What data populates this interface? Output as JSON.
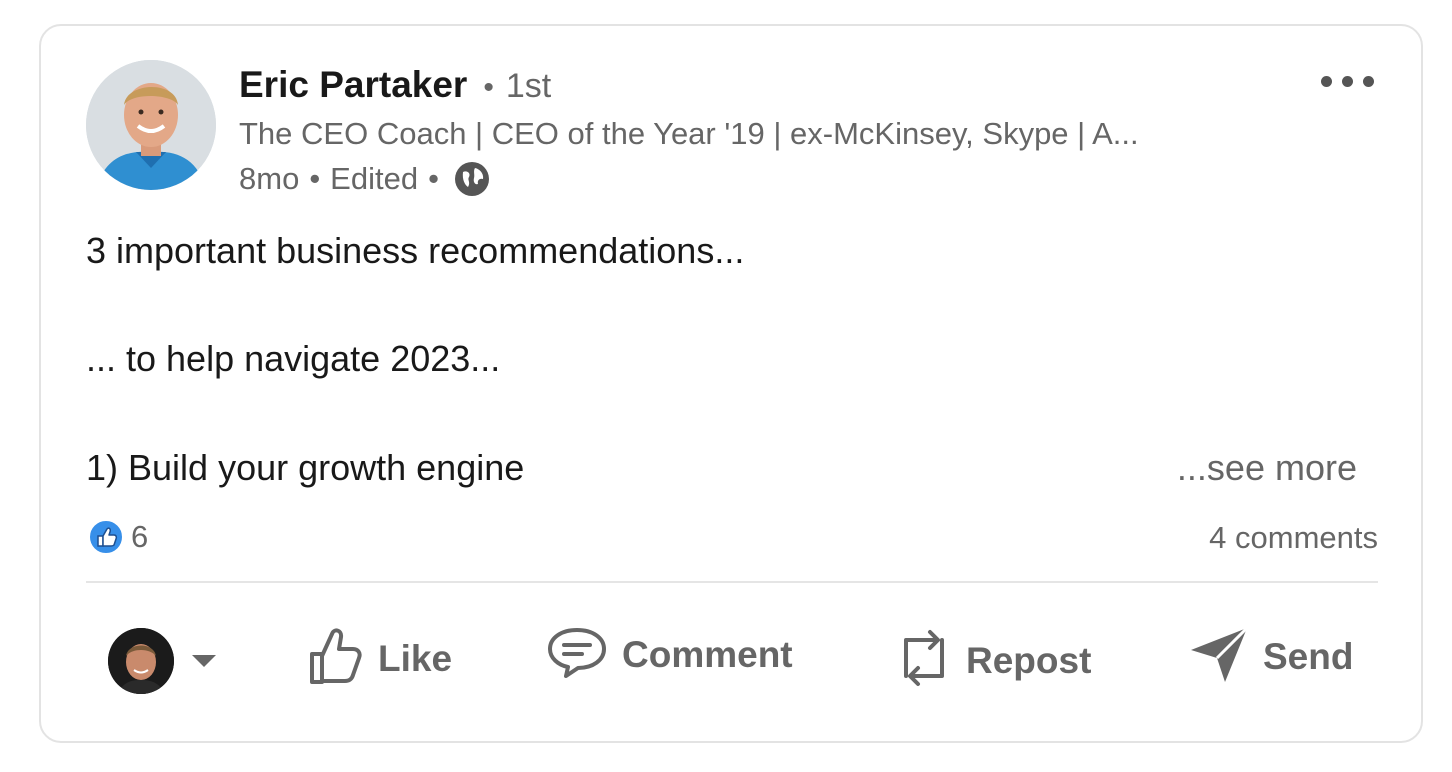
{
  "post": {
    "author": {
      "name": "Eric Partaker",
      "degree": "1st",
      "headline": "The CEO Coach | CEO of the Year '19 | ex-McKinsey, Skype | A...",
      "avatar_icon": "author-avatar-photo"
    },
    "meta": {
      "age": "8mo",
      "edited": "Edited",
      "visibility_icon": "globe-icon"
    },
    "more_icon": "more-options-icon",
    "text": {
      "line1": "3 important business recommendations...",
      "line2": "... to help navigate 2023...",
      "line3": "1) Build your growth engine",
      "see_more": "...see more"
    },
    "social": {
      "reaction_icon": "like-reaction-icon",
      "reaction_count": "6",
      "comments": "4 comments"
    },
    "actions": {
      "actor_icon": "current-user-avatar",
      "like": "Like",
      "comment": "Comment",
      "repost": "Repost",
      "send": "Send"
    }
  },
  "colors": {
    "muted_text": "#666666",
    "primary_text": "#191919",
    "like_blue": "#378fe9",
    "border": "#e3e3e3"
  }
}
